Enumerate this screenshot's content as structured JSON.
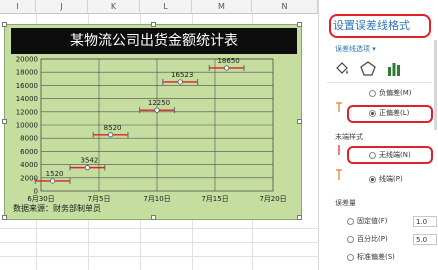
{
  "sheet": {
    "columns": [
      "I",
      "J",
      "K",
      "L",
      "M",
      "N"
    ]
  },
  "chart_data": {
    "type": "scatter",
    "title": "某物流公司出货金额统计表",
    "source_note": "数据来源：财务部制单员",
    "x_ticks": [
      "6月30日",
      "7月5日",
      "7月10日",
      "7月15日",
      "7月20日"
    ],
    "y_ticks": [
      "0",
      "2000",
      "4000",
      "6000",
      "8000",
      "10000",
      "12000",
      "14000",
      "16000",
      "18000",
      "20000"
    ],
    "ylim": [
      0,
      20000
    ],
    "xlim": [
      "2023-06-30",
      "2023-07-20"
    ],
    "points": [
      {
        "x": "2023-07-01",
        "y": 1520,
        "label": "1520"
      },
      {
        "x": "2023-07-04",
        "y": 3542,
        "label": "3542"
      },
      {
        "x": "2023-07-06",
        "y": 8520,
        "label": "8520"
      },
      {
        "x": "2023-07-10",
        "y": 12250,
        "label": "12250"
      },
      {
        "x": "2023-07-12",
        "y": 16523,
        "label": "16523"
      },
      {
        "x": "2023-07-16",
        "y": 18650,
        "label": "18650"
      }
    ],
    "error_bar_color": "#e0202a",
    "grid": true,
    "plot_bg": "#c5dea0",
    "title_bg": "#0d0d0d"
  },
  "panel": {
    "title": "设置误差线格式",
    "subtitle": "误差线选项 ▾",
    "tab_icons": [
      "fill-bucket-icon",
      "pentagon-icon",
      "bar-chart-icon"
    ],
    "direction_options": [
      {
        "label": "负偏差(M)",
        "checked": false
      },
      {
        "label": "正偏差(L)",
        "checked": true
      }
    ],
    "end_style_label": "末端样式",
    "end_style_options": [
      {
        "label": "无线端(N)",
        "checked": false
      },
      {
        "label": "线端(P)",
        "checked": true
      }
    ],
    "error_amount_label": "误差量",
    "amount_options": [
      {
        "label": "固定值(F)",
        "value": "1.0"
      },
      {
        "label": "百分比(P)",
        "value": "5.0"
      },
      {
        "label": "标准偏差(S)",
        "value": ""
      }
    ],
    "accent_color": "#2e75b6",
    "highlight_color": "#e0202a"
  }
}
